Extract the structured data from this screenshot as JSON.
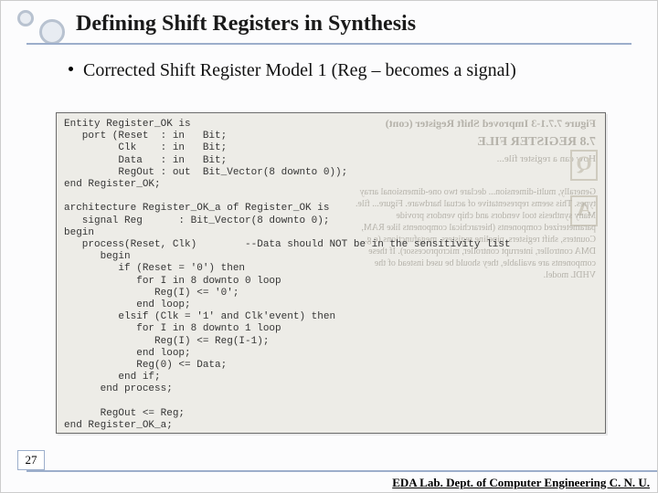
{
  "title": "Defining Shift Registers in Synthesis",
  "bullet": "Corrected Shift Register Model 1 (Reg – becomes a signal)",
  "code": "Entity Register_OK is\n   port (Reset  : in   Bit;\n         Clk    : in   Bit;\n         Data   : in   Bit;\n         RegOut : out  Bit_Vector(8 downto 0));\nend Register_OK;\n\narchitecture Register_OK_a of Register_OK is\n   signal Reg      : Bit_Vector(8 downto 0);\nbegin\n   process(Reset, Clk)        --Data should NOT be in the sensitivity list\n      begin\n         if (Reset = '0') then\n            for I in 8 downto 0 loop\n               Reg(I) <= '0';\n            end loop;\n         elsif (Clk = '1' and Clk'event) then\n            for I in 8 downto 1 loop\n               Reg(I) <= Reg(I-1);\n            end loop;\n            Reg(0) <= Data;\n         end if;\n      end process;\n\n      RegOut <= Reg;\nend Register_OK_a;",
  "ghost": {
    "line0": "Figure 7.7.1-3 Improved Shift Register (cont)",
    "line1": "7.8 REGISTER FILE",
    "line2": "How can a register file...",
    "para": "Generally, multi-dimension... declare two one-dimensional array types. This seems representative of actual hardware. Figure... file. Many synthesis tool vendors and chip vendors provide parameterized components (hierarchical components like RAM, Counters, shift registers, pipeline registers, megafunctions (e.g. DMA controller, interrupt controller, microprocessor). If these components are available, they should be used instead of the VHDL model.",
    "q": "Q",
    "a": "A"
  },
  "page_number": "27",
  "footer": "EDA Lab. Dept. of Computer Engineering C. N. U."
}
